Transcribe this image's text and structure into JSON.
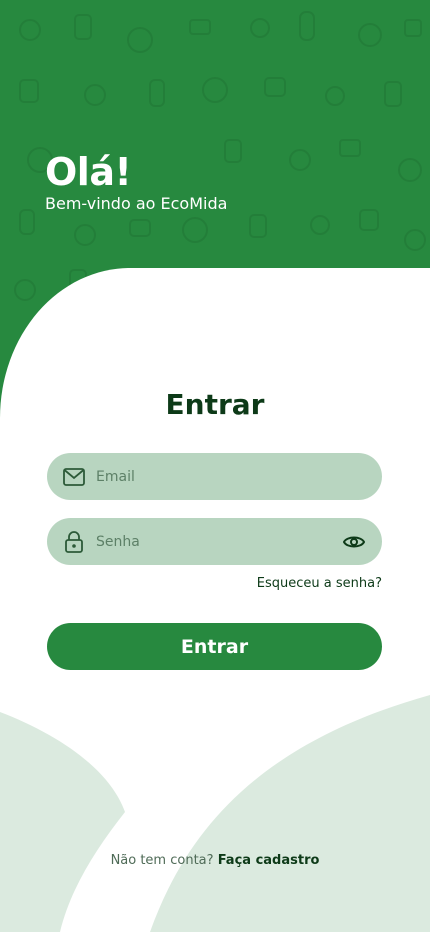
{
  "header": {
    "greeting": "Olá!",
    "welcome_prefix": "Bem-vindo ao ",
    "brand": "EcoMida"
  },
  "login": {
    "title": "Entrar",
    "email_placeholder": "Email",
    "password_placeholder": "Senha",
    "forgot_password": "Esqueceu a senha?",
    "submit_label": "Entrar"
  },
  "footer": {
    "no_account": "Não tem conta?",
    "signup_link": "Faça cadastro"
  },
  "icons": {
    "email": "mail-icon",
    "password": "lock-icon",
    "toggle_visibility": "eye-icon"
  },
  "colors": {
    "primary": "#27893f",
    "field_bg": "#b8d5c0",
    "dark_text": "#0d3a18",
    "decor_shape": "#dbeadf"
  }
}
